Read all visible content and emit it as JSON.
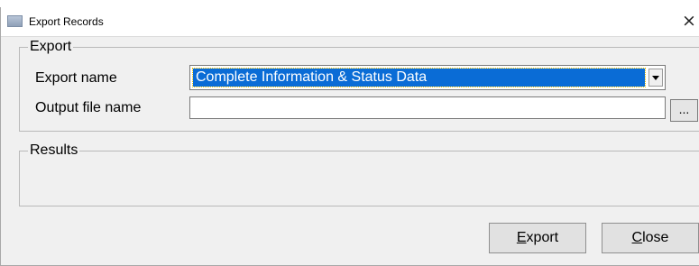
{
  "window": {
    "title": "Export Records",
    "close_glyph": "×"
  },
  "export_group": {
    "label": "Export",
    "export_name_label": "Export name",
    "export_name_value": "Complete Information & Status Data",
    "output_file_label": "Output file name",
    "output_file_value": "",
    "browse_label": "..."
  },
  "results_group": {
    "label": "Results"
  },
  "buttons": {
    "export": {
      "mnemonic": "E",
      "rest": "xport"
    },
    "close": {
      "mnemonic": "C",
      "rest": "lose"
    }
  },
  "colors": {
    "selection": "#0a6cd6",
    "dialog_bg": "#f0f0f0"
  }
}
